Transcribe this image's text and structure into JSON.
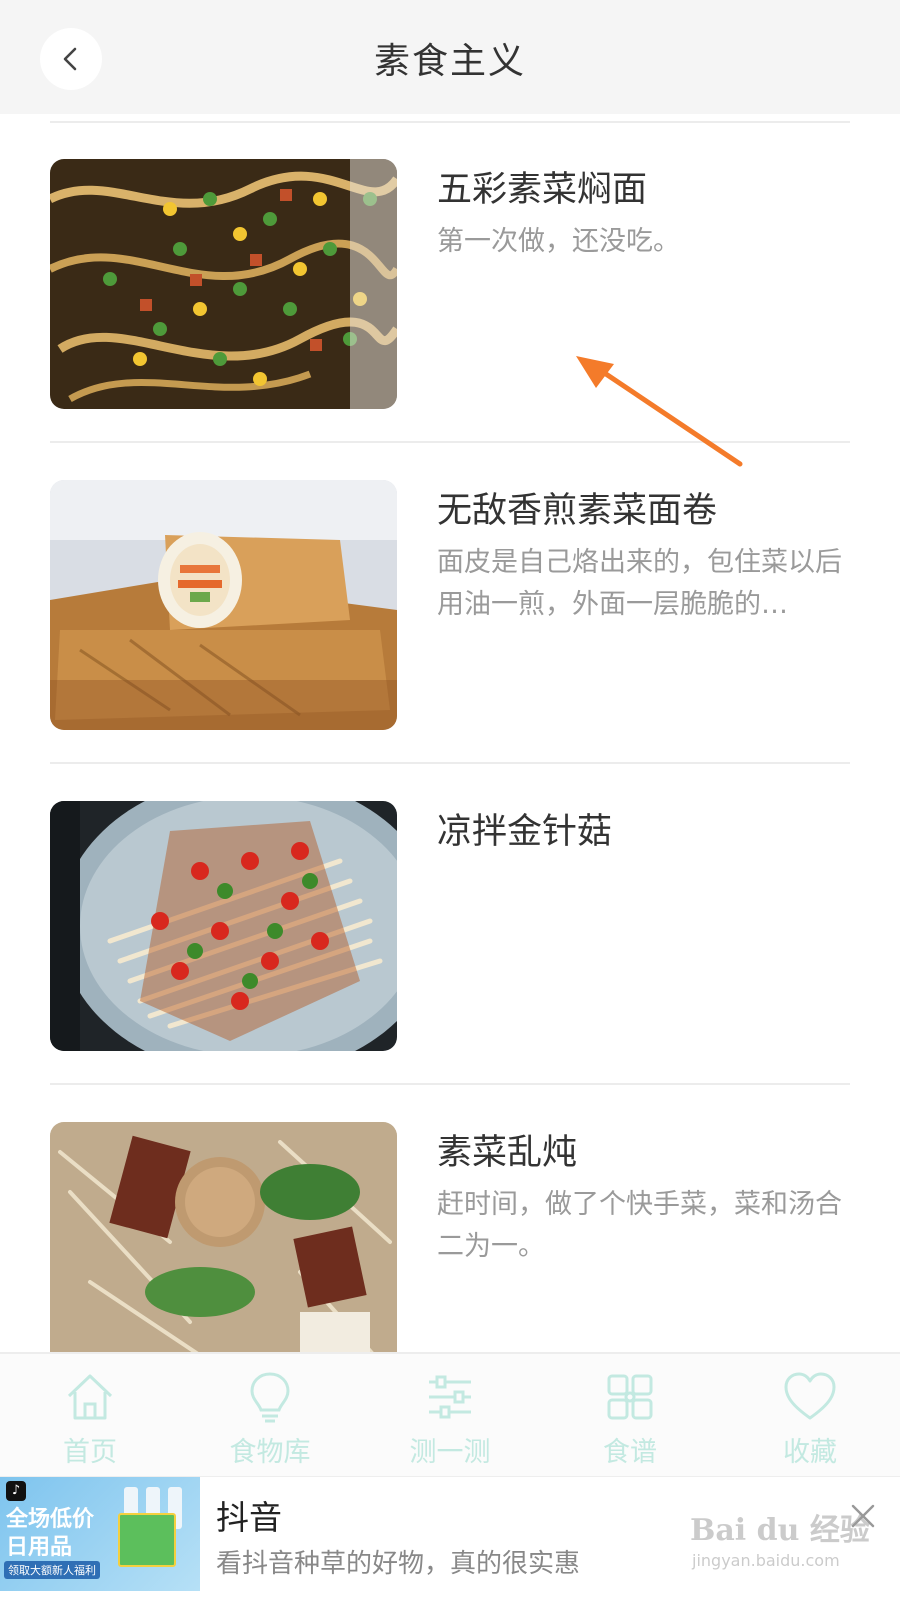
{
  "header": {
    "title": "素食主义",
    "back_icon": "chevron-left-icon"
  },
  "recipes": [
    {
      "title": "五彩素菜焖面",
      "desc": "第一次做，还没吃。",
      "image": "colorful-vegetable-noodles"
    },
    {
      "title": "无敌香煎素菜面卷",
      "desc": "面皮是自己烙出来的，包住菜以后用油一煎，外面一层脆脆的…",
      "image": "pan-fried-vegetable-roll"
    },
    {
      "title": "凉拌金针菇",
      "desc": "",
      "image": "cold-enoki-mushroom-salad"
    },
    {
      "title": "素菜乱炖",
      "desc": "赶时间，做了个快手菜，菜和汤合二为一。",
      "image": "vegetable-stew"
    }
  ],
  "tabbar": [
    {
      "label": "首页",
      "icon": "home-icon"
    },
    {
      "label": "食物库",
      "icon": "lightbulb-icon"
    },
    {
      "label": "测一测",
      "icon": "sliders-icon"
    },
    {
      "label": "食谱",
      "icon": "grid-icon"
    },
    {
      "label": "收藏",
      "icon": "heart-icon"
    }
  ],
  "ad": {
    "title": "抖音",
    "desc": "看抖音种草的好物，真的很实惠",
    "thumb_line1": "全场低价",
    "thumb_line2": "日用品",
    "thumb_tag": "领取大额新人福利",
    "close_icon": "close-icon"
  },
  "watermark": {
    "brand": "Bai du 经验",
    "url": "jingyan.baidu.com"
  },
  "colors": {
    "tab_inactive": "#c3e9e1",
    "annotation_arrow": "#f47b2a",
    "header_bg": "#f5f5f5"
  }
}
